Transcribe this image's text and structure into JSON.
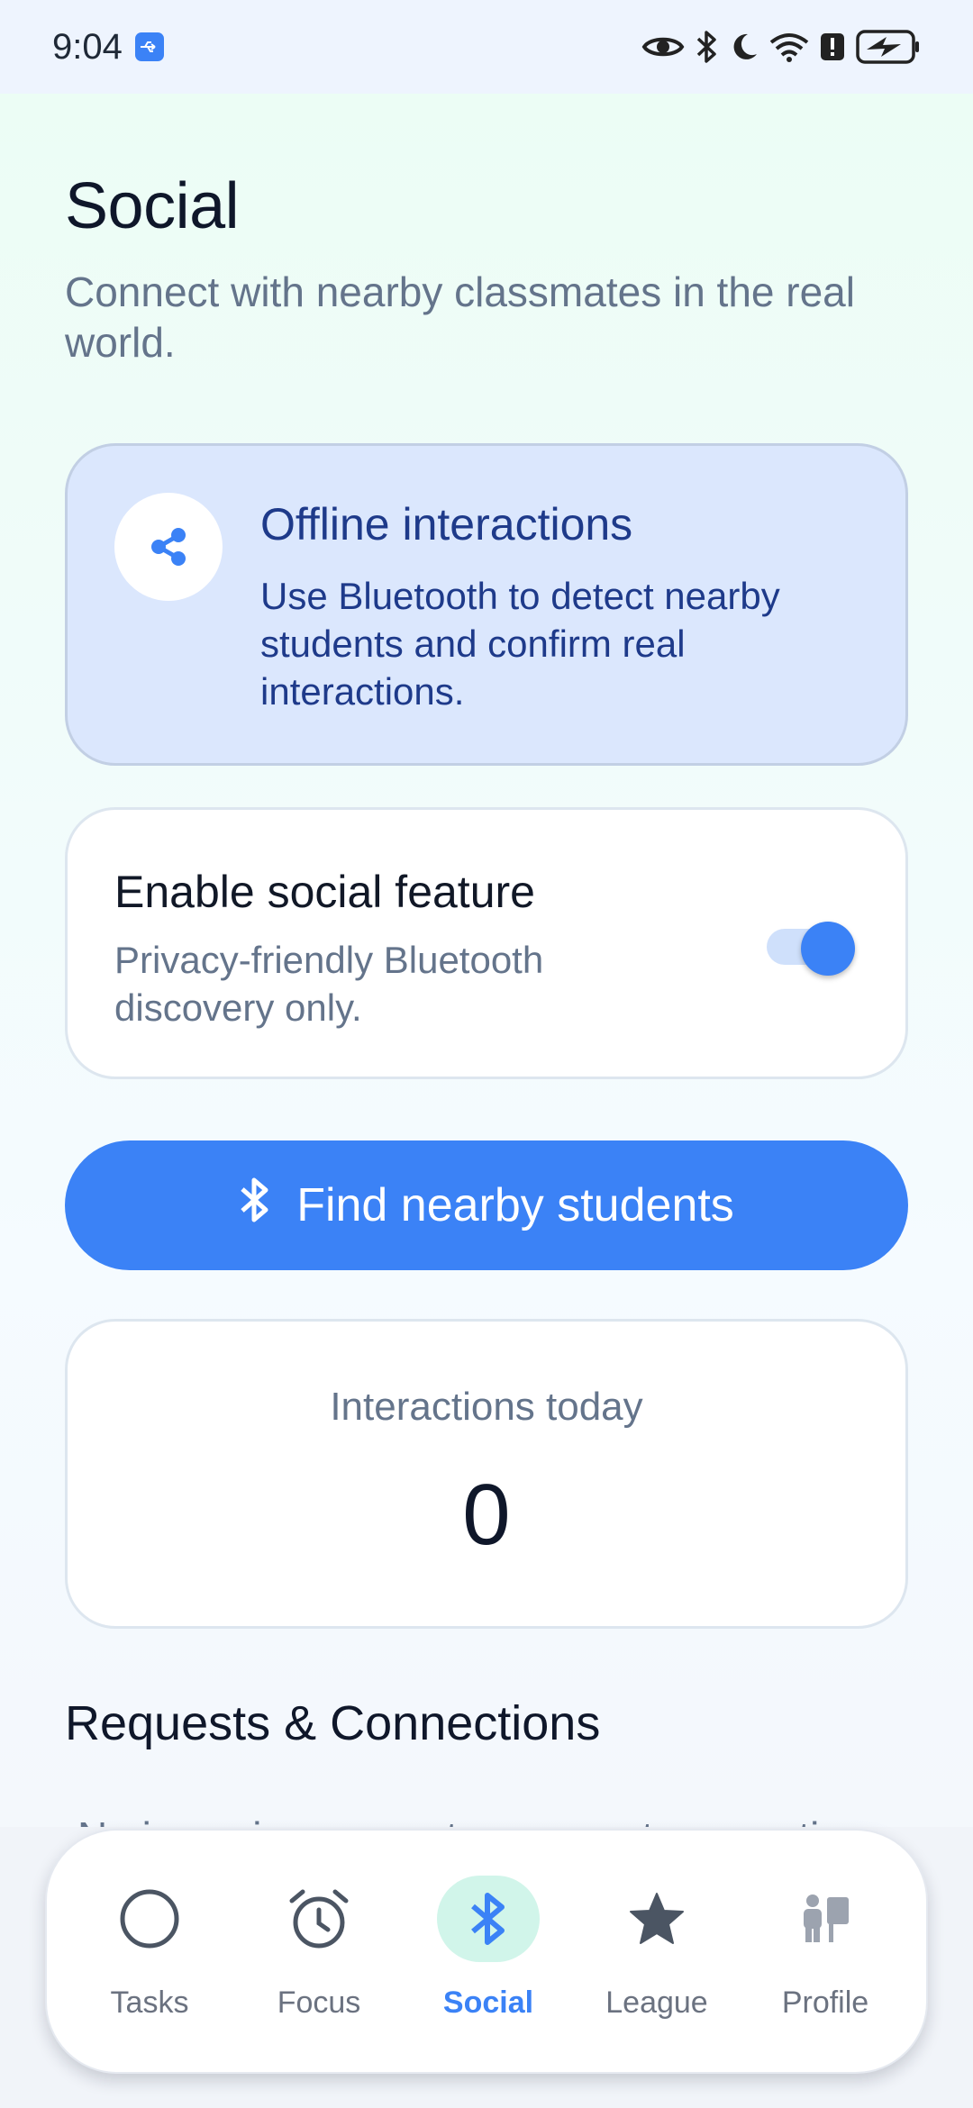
{
  "status_bar": {
    "time": "9:04",
    "icons": [
      "usb-icon",
      "eye-icon",
      "bluetooth-icon",
      "moon-icon",
      "wifi-icon",
      "alert-icon",
      "battery-charging-icon"
    ]
  },
  "header": {
    "title": "Social",
    "subtitle": "Connect with nearby classmates in the real world."
  },
  "info_card": {
    "icon": "share-icon",
    "title": "Offline interactions",
    "text": "Use Bluetooth to detect nearby students and confirm real interactions."
  },
  "toggle_card": {
    "title": "Enable social feature",
    "subtitle": "Privacy-friendly Bluetooth discovery only.",
    "enabled": true
  },
  "find_button": {
    "icon": "bluetooth-icon",
    "label": "Find nearby students"
  },
  "stats": {
    "label": "Interactions today",
    "value": "0"
  },
  "requests": {
    "title": "Requests & Connections",
    "empty_text": "No incoming requests or recent connections."
  },
  "bottom_nav": {
    "items": [
      {
        "label": "Tasks",
        "icon": "circle-icon",
        "active": false
      },
      {
        "label": "Focus",
        "icon": "alarm-clock-icon",
        "active": false
      },
      {
        "label": "Social",
        "icon": "bluetooth-icon",
        "active": true
      },
      {
        "label": "League",
        "icon": "star-icon",
        "active": false
      },
      {
        "label": "Profile",
        "icon": "profile-figure-icon",
        "active": false
      }
    ]
  },
  "colors": {
    "accent": "#3b82f6",
    "active_nav_bg": "#d1f5ea",
    "info_card_bg": "#dbe7fd",
    "info_text": "#1e3a8a"
  }
}
